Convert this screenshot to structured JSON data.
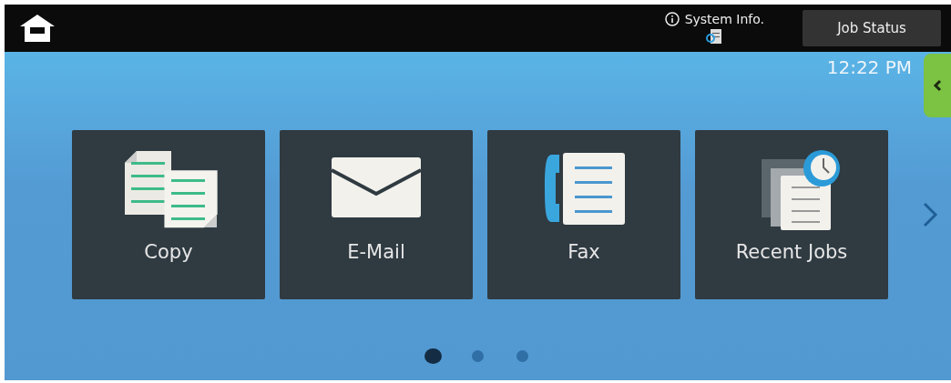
{
  "top_bar": {
    "system_info": "System Info.",
    "job_status": "Job Status"
  },
  "clock": "12:22 PM",
  "tiles": [
    {
      "kind": "copy",
      "label": "Copy"
    },
    {
      "kind": "email",
      "label": "E-Mail"
    },
    {
      "kind": "fax",
      "label": "Fax"
    },
    {
      "kind": "recent",
      "label": "Recent Jobs"
    }
  ],
  "pages": [
    {
      "selected": true
    },
    {
      "selected": false
    },
    {
      "selected": false
    }
  ]
}
